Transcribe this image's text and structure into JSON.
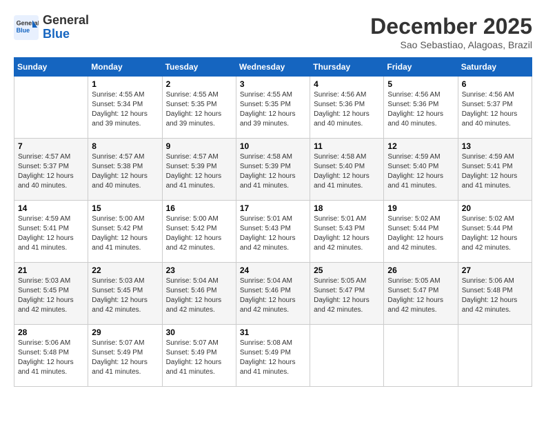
{
  "header": {
    "logo_line1": "General",
    "logo_line2": "Blue",
    "month": "December 2025",
    "location": "Sao Sebastiao, Alagoas, Brazil"
  },
  "days_of_week": [
    "Sunday",
    "Monday",
    "Tuesday",
    "Wednesday",
    "Thursday",
    "Friday",
    "Saturday"
  ],
  "weeks": [
    [
      {
        "day": "",
        "info": ""
      },
      {
        "day": "1",
        "info": "Sunrise: 4:55 AM\nSunset: 5:34 PM\nDaylight: 12 hours\nand 39 minutes."
      },
      {
        "day": "2",
        "info": "Sunrise: 4:55 AM\nSunset: 5:35 PM\nDaylight: 12 hours\nand 39 minutes."
      },
      {
        "day": "3",
        "info": "Sunrise: 4:55 AM\nSunset: 5:35 PM\nDaylight: 12 hours\nand 39 minutes."
      },
      {
        "day": "4",
        "info": "Sunrise: 4:56 AM\nSunset: 5:36 PM\nDaylight: 12 hours\nand 40 minutes."
      },
      {
        "day": "5",
        "info": "Sunrise: 4:56 AM\nSunset: 5:36 PM\nDaylight: 12 hours\nand 40 minutes."
      },
      {
        "day": "6",
        "info": "Sunrise: 4:56 AM\nSunset: 5:37 PM\nDaylight: 12 hours\nand 40 minutes."
      }
    ],
    [
      {
        "day": "7",
        "info": "Sunrise: 4:57 AM\nSunset: 5:37 PM\nDaylight: 12 hours\nand 40 minutes."
      },
      {
        "day": "8",
        "info": "Sunrise: 4:57 AM\nSunset: 5:38 PM\nDaylight: 12 hours\nand 40 minutes."
      },
      {
        "day": "9",
        "info": "Sunrise: 4:57 AM\nSunset: 5:39 PM\nDaylight: 12 hours\nand 41 minutes."
      },
      {
        "day": "10",
        "info": "Sunrise: 4:58 AM\nSunset: 5:39 PM\nDaylight: 12 hours\nand 41 minutes."
      },
      {
        "day": "11",
        "info": "Sunrise: 4:58 AM\nSunset: 5:40 PM\nDaylight: 12 hours\nand 41 minutes."
      },
      {
        "day": "12",
        "info": "Sunrise: 4:59 AM\nSunset: 5:40 PM\nDaylight: 12 hours\nand 41 minutes."
      },
      {
        "day": "13",
        "info": "Sunrise: 4:59 AM\nSunset: 5:41 PM\nDaylight: 12 hours\nand 41 minutes."
      }
    ],
    [
      {
        "day": "14",
        "info": "Sunrise: 4:59 AM\nSunset: 5:41 PM\nDaylight: 12 hours\nand 41 minutes."
      },
      {
        "day": "15",
        "info": "Sunrise: 5:00 AM\nSunset: 5:42 PM\nDaylight: 12 hours\nand 41 minutes."
      },
      {
        "day": "16",
        "info": "Sunrise: 5:00 AM\nSunset: 5:42 PM\nDaylight: 12 hours\nand 42 minutes."
      },
      {
        "day": "17",
        "info": "Sunrise: 5:01 AM\nSunset: 5:43 PM\nDaylight: 12 hours\nand 42 minutes."
      },
      {
        "day": "18",
        "info": "Sunrise: 5:01 AM\nSunset: 5:43 PM\nDaylight: 12 hours\nand 42 minutes."
      },
      {
        "day": "19",
        "info": "Sunrise: 5:02 AM\nSunset: 5:44 PM\nDaylight: 12 hours\nand 42 minutes."
      },
      {
        "day": "20",
        "info": "Sunrise: 5:02 AM\nSunset: 5:44 PM\nDaylight: 12 hours\nand 42 minutes."
      }
    ],
    [
      {
        "day": "21",
        "info": "Sunrise: 5:03 AM\nSunset: 5:45 PM\nDaylight: 12 hours\nand 42 minutes."
      },
      {
        "day": "22",
        "info": "Sunrise: 5:03 AM\nSunset: 5:45 PM\nDaylight: 12 hours\nand 42 minutes."
      },
      {
        "day": "23",
        "info": "Sunrise: 5:04 AM\nSunset: 5:46 PM\nDaylight: 12 hours\nand 42 minutes."
      },
      {
        "day": "24",
        "info": "Sunrise: 5:04 AM\nSunset: 5:46 PM\nDaylight: 12 hours\nand 42 minutes."
      },
      {
        "day": "25",
        "info": "Sunrise: 5:05 AM\nSunset: 5:47 PM\nDaylight: 12 hours\nand 42 minutes."
      },
      {
        "day": "26",
        "info": "Sunrise: 5:05 AM\nSunset: 5:47 PM\nDaylight: 12 hours\nand 42 minutes."
      },
      {
        "day": "27",
        "info": "Sunrise: 5:06 AM\nSunset: 5:48 PM\nDaylight: 12 hours\nand 42 minutes."
      }
    ],
    [
      {
        "day": "28",
        "info": "Sunrise: 5:06 AM\nSunset: 5:48 PM\nDaylight: 12 hours\nand 41 minutes."
      },
      {
        "day": "29",
        "info": "Sunrise: 5:07 AM\nSunset: 5:49 PM\nDaylight: 12 hours\nand 41 minutes."
      },
      {
        "day": "30",
        "info": "Sunrise: 5:07 AM\nSunset: 5:49 PM\nDaylight: 12 hours\nand 41 minutes."
      },
      {
        "day": "31",
        "info": "Sunrise: 5:08 AM\nSunset: 5:49 PM\nDaylight: 12 hours\nand 41 minutes."
      },
      {
        "day": "",
        "info": ""
      },
      {
        "day": "",
        "info": ""
      },
      {
        "day": "",
        "info": ""
      }
    ]
  ]
}
